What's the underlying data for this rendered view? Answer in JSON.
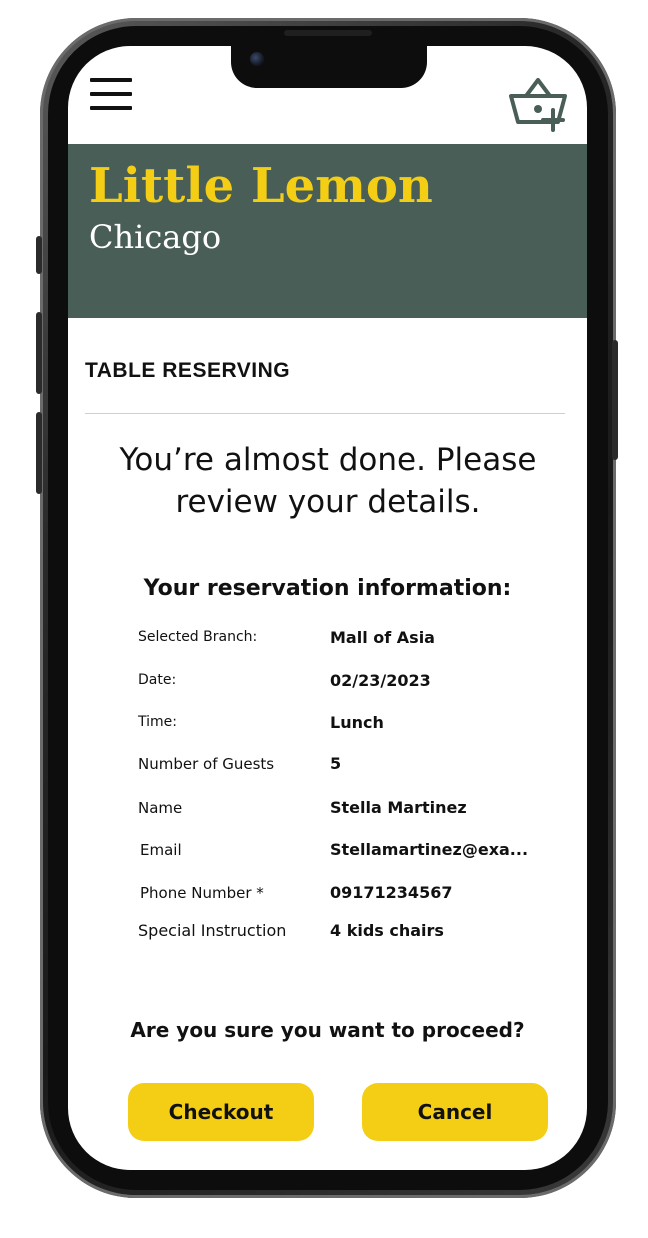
{
  "header": {
    "menu_icon": "hamburger-menu-icon",
    "cart_icon": "basket-add-icon"
  },
  "hero": {
    "title": "Little Lemon",
    "subtitle": "Chicago"
  },
  "page": {
    "section_title": "TABLE RESERVING",
    "headline": "You’re almost done. Please review your details.",
    "info_title": "Your reservation information:"
  },
  "reservation": [
    {
      "label": "Selected Branch:",
      "value": "Mall of Asia"
    },
    {
      "label": "Date:",
      "value": "02/23/2023"
    },
    {
      "label": "Time:",
      "value": "Lunch"
    },
    {
      "label": "Number of Guests",
      "value": "5"
    },
    {
      "label": "Name",
      "value": "Stella Martinez"
    },
    {
      "label": "Email",
      "value": "Stellamartinez@exa..."
    },
    {
      "label": "Phone Number *",
      "value": "09171234567"
    },
    {
      "label": "Special Instruction",
      "value": "4 kids chairs"
    }
  ],
  "confirm": {
    "question": "Are you sure you want to proceed?",
    "checkout_label": "Checkout",
    "cancel_label": "Cancel"
  },
  "colors": {
    "primary_green": "#495e57",
    "primary_yellow": "#f4ce14"
  }
}
